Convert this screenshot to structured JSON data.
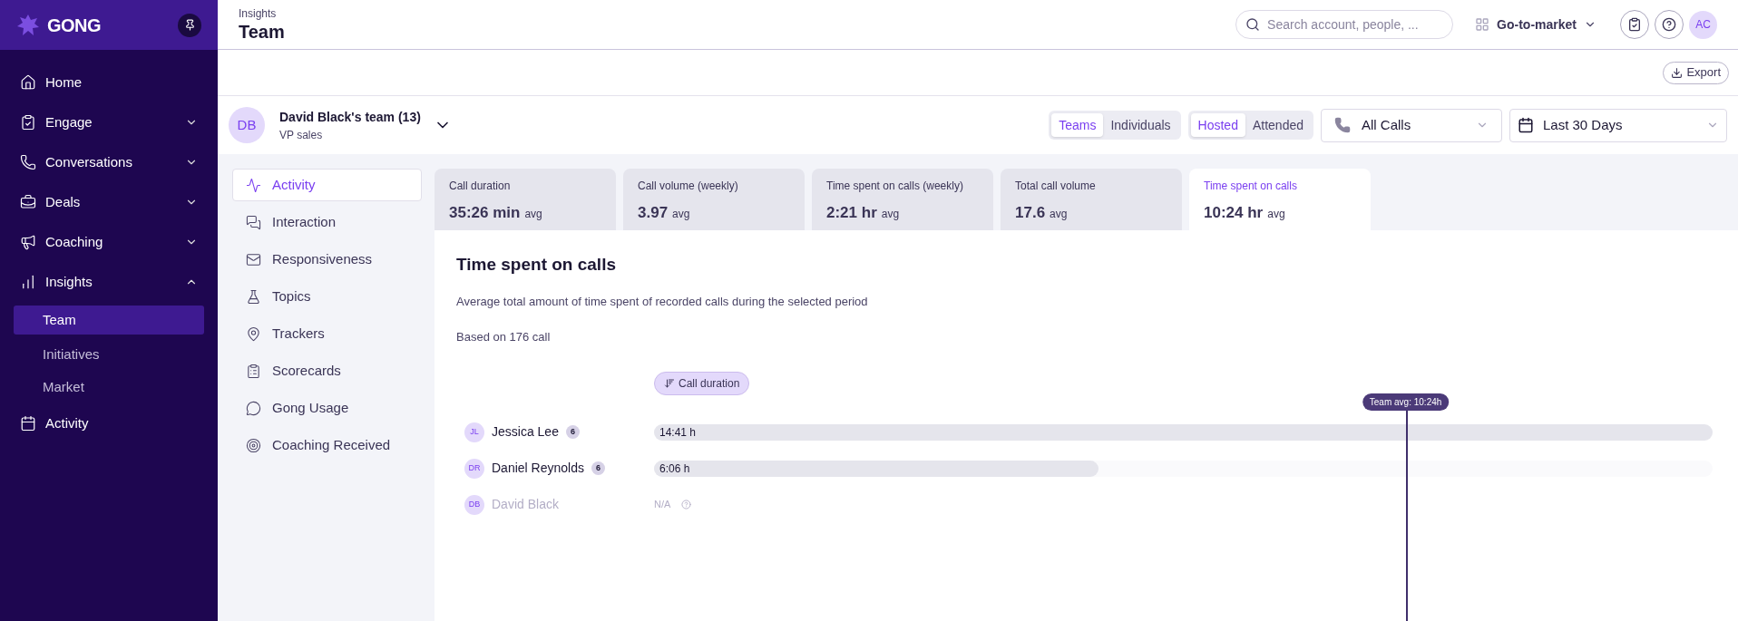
{
  "sidebar": {
    "logo": "GONG",
    "items": [
      {
        "label": "Home"
      },
      {
        "label": "Engage",
        "expanded": false
      },
      {
        "label": "Conversations",
        "expanded": false
      },
      {
        "label": "Deals",
        "expanded": false
      },
      {
        "label": "Coaching",
        "expanded": false
      },
      {
        "label": "Insights",
        "expanded": true,
        "children": [
          {
            "label": "Team",
            "selected": true
          },
          {
            "label": "Initiatives",
            "selected": false
          },
          {
            "label": "Market",
            "selected": false
          }
        ]
      },
      {
        "label": "Activity"
      }
    ]
  },
  "header": {
    "breadcrumb": "Insights",
    "title": "Team",
    "search": {
      "placeholder": "Search account, people, ..."
    },
    "workspace": "Go-to-market",
    "avatar": "AC"
  },
  "toolbar": {
    "export": "Export"
  },
  "team": {
    "initials": "DB",
    "name": "David Black's team (13)",
    "role": "VP sales"
  },
  "filters": {
    "view_toggle": [
      {
        "label": "Teams",
        "selected": true
      },
      {
        "label": "Individuals",
        "selected": false
      }
    ],
    "call_toggle": [
      {
        "label": "Hosted",
        "selected": true
      },
      {
        "label": "Attended",
        "selected": false
      }
    ],
    "call_type": "All Calls",
    "date_range": "Last 30 Days"
  },
  "metrics_nav": [
    {
      "label": "Activity",
      "selected": true
    },
    {
      "label": "Interaction",
      "selected": false
    },
    {
      "label": "Responsiveness",
      "selected": false
    },
    {
      "label": "Topics",
      "selected": false
    },
    {
      "label": "Trackers",
      "selected": false
    },
    {
      "label": "Scorecards",
      "selected": false
    },
    {
      "label": "Gong Usage",
      "selected": false
    },
    {
      "label": "Coaching Received",
      "selected": false
    }
  ],
  "metric_cards": [
    {
      "label": "Call duration",
      "value": "35:26 min",
      "unit": "avg",
      "selected": false
    },
    {
      "label": "Call volume (weekly)",
      "value": "3.97",
      "unit": "avg",
      "selected": false
    },
    {
      "label": "Time spent on calls (weekly)",
      "value": "2:21 hr",
      "unit": "avg",
      "selected": false
    },
    {
      "label": "Total call volume",
      "value": "17.6",
      "unit": "avg",
      "selected": false
    },
    {
      "label": "Time spent on calls",
      "value": "10:24 hr",
      "unit": "avg",
      "selected": true
    }
  ],
  "panel": {
    "title": "Time spent on calls",
    "description": "Average total amount of time spent of recorded calls during the selected period",
    "based_on": "Based on 176 call",
    "sort_chip": "Call duration",
    "team_avg": {
      "label": "Team avg: 10:24h",
      "level": 0.71
    },
    "rows": [
      {
        "initials": "JL",
        "name": "Jessica Lee",
        "count": "6",
        "value": "14:41 h",
        "level": 1,
        "muted": false
      },
      {
        "initials": "DR",
        "name": "Daniel Reynolds",
        "count": "6",
        "value": "6:06 h",
        "level": 0.42,
        "muted": false
      },
      {
        "initials": "DB",
        "name": "David Black",
        "value": "N/A",
        "muted": true
      }
    ]
  }
}
